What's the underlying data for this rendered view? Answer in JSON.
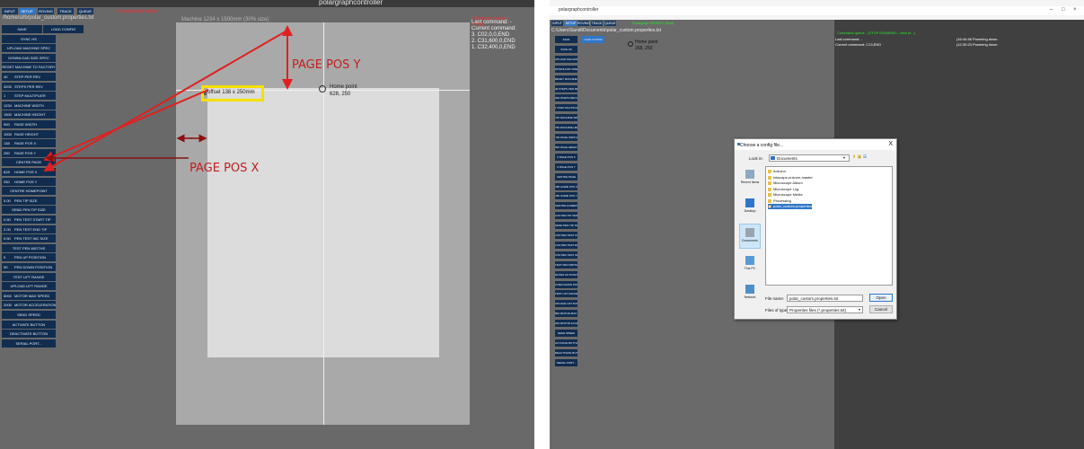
{
  "left": {
    "window_title": "polargraphcontroller",
    "tabs": [
      "INPUT",
      "SETUP",
      "ROVING",
      "TRACE",
      "QUEUE"
    ],
    "active_tab": "SETUP",
    "status": "No serial connection",
    "path": "/home/sl/b/polar_custom.properties.txt",
    "machine_title": "Machine 1234 x 1500mm (30% size)",
    "offset_label": "offset 138 x 250mm",
    "home_label": "Home point",
    "home_value": "628, 250",
    "lastcmd_red": "Command queue - ST/ST...",
    "lastcmd_lines": [
      "Last command: -",
      "Current command:",
      "3. C02,0,0,END",
      "2. C31,600,0,END",
      "1. C32,400,0,END"
    ],
    "buttons": [
      {
        "num": "",
        "label": "SAVE"
      },
      {
        "num": "",
        "label": "LOAD CONFIG"
      },
      {
        "num": "",
        "label": "SYNC HS"
      },
      {
        "num": "",
        "label": "UPLOAD MACHINE SPEC"
      },
      {
        "num": "",
        "label": "DOWNLOAD SIZE SPEC"
      },
      {
        "num": "",
        "label": "RESET MACHINE TO FACTORY"
      },
      {
        "num": "40",
        "label": "STEP PER REV"
      },
      {
        "num": "3200",
        "label": "STEPS PER REV"
      },
      {
        "num": "1",
        "label": "STEP MULTIPLIER"
      },
      {
        "num": "1234",
        "label": "MACHINE WIDTH"
      },
      {
        "num": "1500",
        "label": "MACHINE HEIGHT"
      },
      {
        "num": "900",
        "label": "PAGE WIDTH"
      },
      {
        "num": "1000",
        "label": "PAGE HEIGHT"
      },
      {
        "num": "138",
        "label": "PAGE POS X"
      },
      {
        "num": "250",
        "label": "PAGE POS Y"
      },
      {
        "num": "",
        "label": "CENTRE PAGE"
      },
      {
        "num": "628",
        "label": "HOME POS X"
      },
      {
        "num": "250",
        "label": "HOME POS Y"
      },
      {
        "num": "",
        "label": "CENTRE HOMEPOINT"
      },
      {
        "num": "0.00",
        "label": "PEN TIP SIZE"
      },
      {
        "num": "",
        "label": "SEND PEN TIP SIZE"
      },
      {
        "num": "0.50",
        "label": "PEN TEST START TIP"
      },
      {
        "num": "2.00",
        "label": "PEN TEST END TIP"
      },
      {
        "num": "0.50",
        "label": "PEN TEST INC SIZE"
      },
      {
        "num": "",
        "label": "TEST PEN WIDTHS"
      },
      {
        "num": "0",
        "label": "PEN UP POSITION"
      },
      {
        "num": "90",
        "label": "PEN DOWN POSITION"
      },
      {
        "num": "",
        "label": "TEST LIFT RANGE"
      },
      {
        "num": "",
        "label": "UPLOAD LIFT RANGE"
      },
      {
        "num": "8000",
        "label": "MOTOR MAX SPEED"
      },
      {
        "num": "2000",
        "label": "MOTOR ACCELERATION"
      },
      {
        "num": "",
        "label": "SEND SPEED"
      },
      {
        "num": "",
        "label": "ACTIVATE BUTTON"
      },
      {
        "num": "",
        "label": "DEACTIVATE BUTTON"
      },
      {
        "num": "",
        "label": "SERIAL PORT..."
      }
    ],
    "annotations": {
      "page_pos_y": "PAGE POS Y",
      "page_pos_x": "PAGE POS X"
    }
  },
  "right": {
    "window_title": "polargraphcontroller",
    "tabs": [
      "INPUT",
      "SETUP",
      "ROVING",
      "TRACE",
      "QUEUE"
    ],
    "active_tab": "SETUP",
    "status": "Polargraph READY! (Ana)",
    "path": "C:\\Users\\Sandi\\Documents\\polar_custom.properties.txt",
    "home_label": "Home point",
    "home_value": "258, 250",
    "green_status": "Command queue - (STOP DRAWING - click to...)",
    "lastcmd_lines": [
      "Last command: -",
      "Current command: C13,END"
    ],
    "timestamps": [
      "(16:44:46 Powering down.",
      "(12:30:23 Powering down."
    ],
    "buttons": [
      "SAVE",
      "SAVE AS",
      "UPLOAD MACHINE SPEC",
      "DOWNLOAD SIZE SPEC",
      "RESET MACHINE TO FACTORY",
      "40  STEPS PER REV",
      "200 STEPS PER REV",
      "1  STEP MULTIPLIER",
      "720 MACHINE WIDTH",
      "790 MACHINE HEIGHT",
      "720 PAGE WIDTH",
      "600 PAGE HEIGHT",
      "0  PAGE POS X",
      "0  PAGE POS Y",
      "CENTRE PAGE",
      "258 HOME POS X",
      "250 HOME POS Y",
      "CENTRE HOMEPOINT",
      "0.00 PEN TIP SIZE",
      "SEND PEN TIP SIZE",
      "0.50 PEN TEST START",
      "2.00 PEN TEST END",
      "0.50 PEN TEST INC",
      "TEST PEN WIDTHS",
      "90 PEN UP POSITION",
      "0  PEN DOWN POSITION",
      "TEST LIFT RANGE",
      "UPLOAD LIFT RANGE",
      "800 MOTOR MAX SPEED",
      "200 MOTOR ACCELERATION",
      "SEND SPEED",
      "ACTIVATE BUTTON",
      "DEACTIVATE BUTTON",
      "SERIAL PORT..."
    ],
    "load_config": "LOAD CONFIG",
    "dialog": {
      "title": "Choose a config file...",
      "close": "X",
      "look_in_label": "Look in:",
      "look_in_value": "Documents",
      "places": [
        "Recent Items",
        "Desktop",
        "Documents",
        "This PC",
        "Network"
      ],
      "files": [
        {
          "name": "Arduino",
          "type": "folder"
        },
        {
          "name": "inkscape-unicorn-master",
          "type": "folder"
        },
        {
          "name": "Microscope Album",
          "type": "folder"
        },
        {
          "name": "Microscope Log",
          "type": "folder"
        },
        {
          "name": "Microscope Media",
          "type": "folder"
        },
        {
          "name": "Processing",
          "type": "folder"
        },
        {
          "name": "polar_custom.properties",
          "type": "file"
        }
      ],
      "file_name_label": "File name:",
      "file_name_value": "polar_custom.properties.txt",
      "file_type_label": "Files of type:",
      "file_type_value": "Properties files (*.properties.txt)",
      "open": "Open",
      "cancel": "Cancel"
    }
  },
  "colors": {
    "accent": "#e02020",
    "button_bg": "#102c4f",
    "tab_active": "#2e77c9",
    "highlight": "#f5e000"
  }
}
